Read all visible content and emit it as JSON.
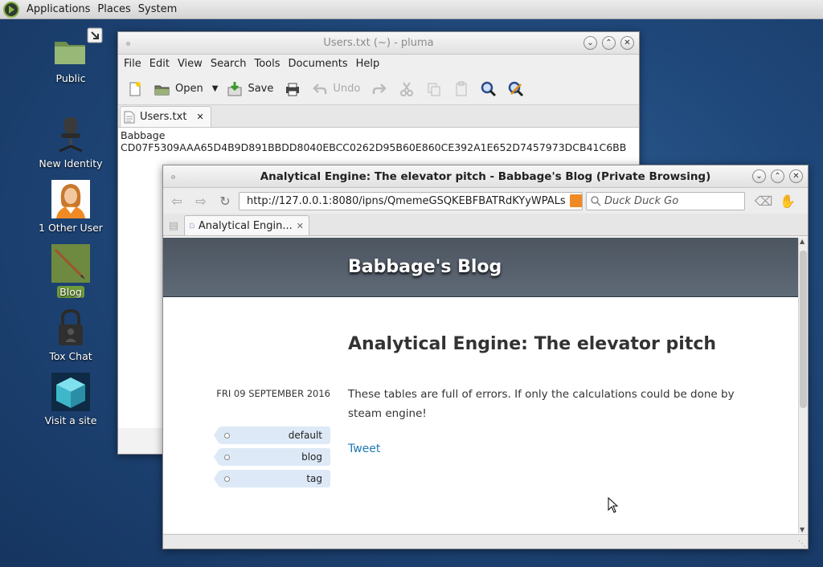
{
  "panel": {
    "menus": [
      "Applications",
      "Places",
      "System"
    ]
  },
  "desktop": {
    "icons": [
      {
        "label": "Public"
      },
      {
        "label": "New Identity"
      },
      {
        "label": "1 Other User"
      },
      {
        "label": "Blog"
      },
      {
        "label": "Tox Chat"
      },
      {
        "label": "Visit a site"
      }
    ]
  },
  "pluma": {
    "title": "Users.txt (~) - pluma",
    "menus": [
      "File",
      "Edit",
      "View",
      "Search",
      "Tools",
      "Documents",
      "Help"
    ],
    "toolbar": {
      "open_label": "Open",
      "save_label": "Save",
      "undo_label": "Undo"
    },
    "tab_label": "Users.txt",
    "content_line1": "Babbage",
    "content_line2": "CD07F5309AAA65D4B9D891BBDD8040EBCC0262D95B60E860CE392A1E652D7457973DCB41C6BB"
  },
  "browser": {
    "title": "Analytical Engine: The elevator pitch - Babbage's Blog (Private Browsing)",
    "url": "http://127.0.0.1:8080/ipns/QmemeGSQKEBFBATRdKYyWPALs",
    "search_placeholder": "Duck Duck Go",
    "tab_label": "Analytical Engin...",
    "blog_title": "Babbage's Blog",
    "post": {
      "title": "Analytical Engine: The elevator pitch",
      "date": "FRI 09 SEPTEMBER 2016",
      "body": "These tables are full of errors. If only the calculations could be done by steam engine!",
      "tweet": "Tweet",
      "tags": [
        "default",
        "blog",
        "tag"
      ]
    }
  },
  "colors": {
    "desktop_bg": "#1f4779",
    "blog_header": "#56606b",
    "link": "#1f7bb8",
    "tag_bg": "#dde9f6",
    "selected_label": "#6e9a3a"
  }
}
